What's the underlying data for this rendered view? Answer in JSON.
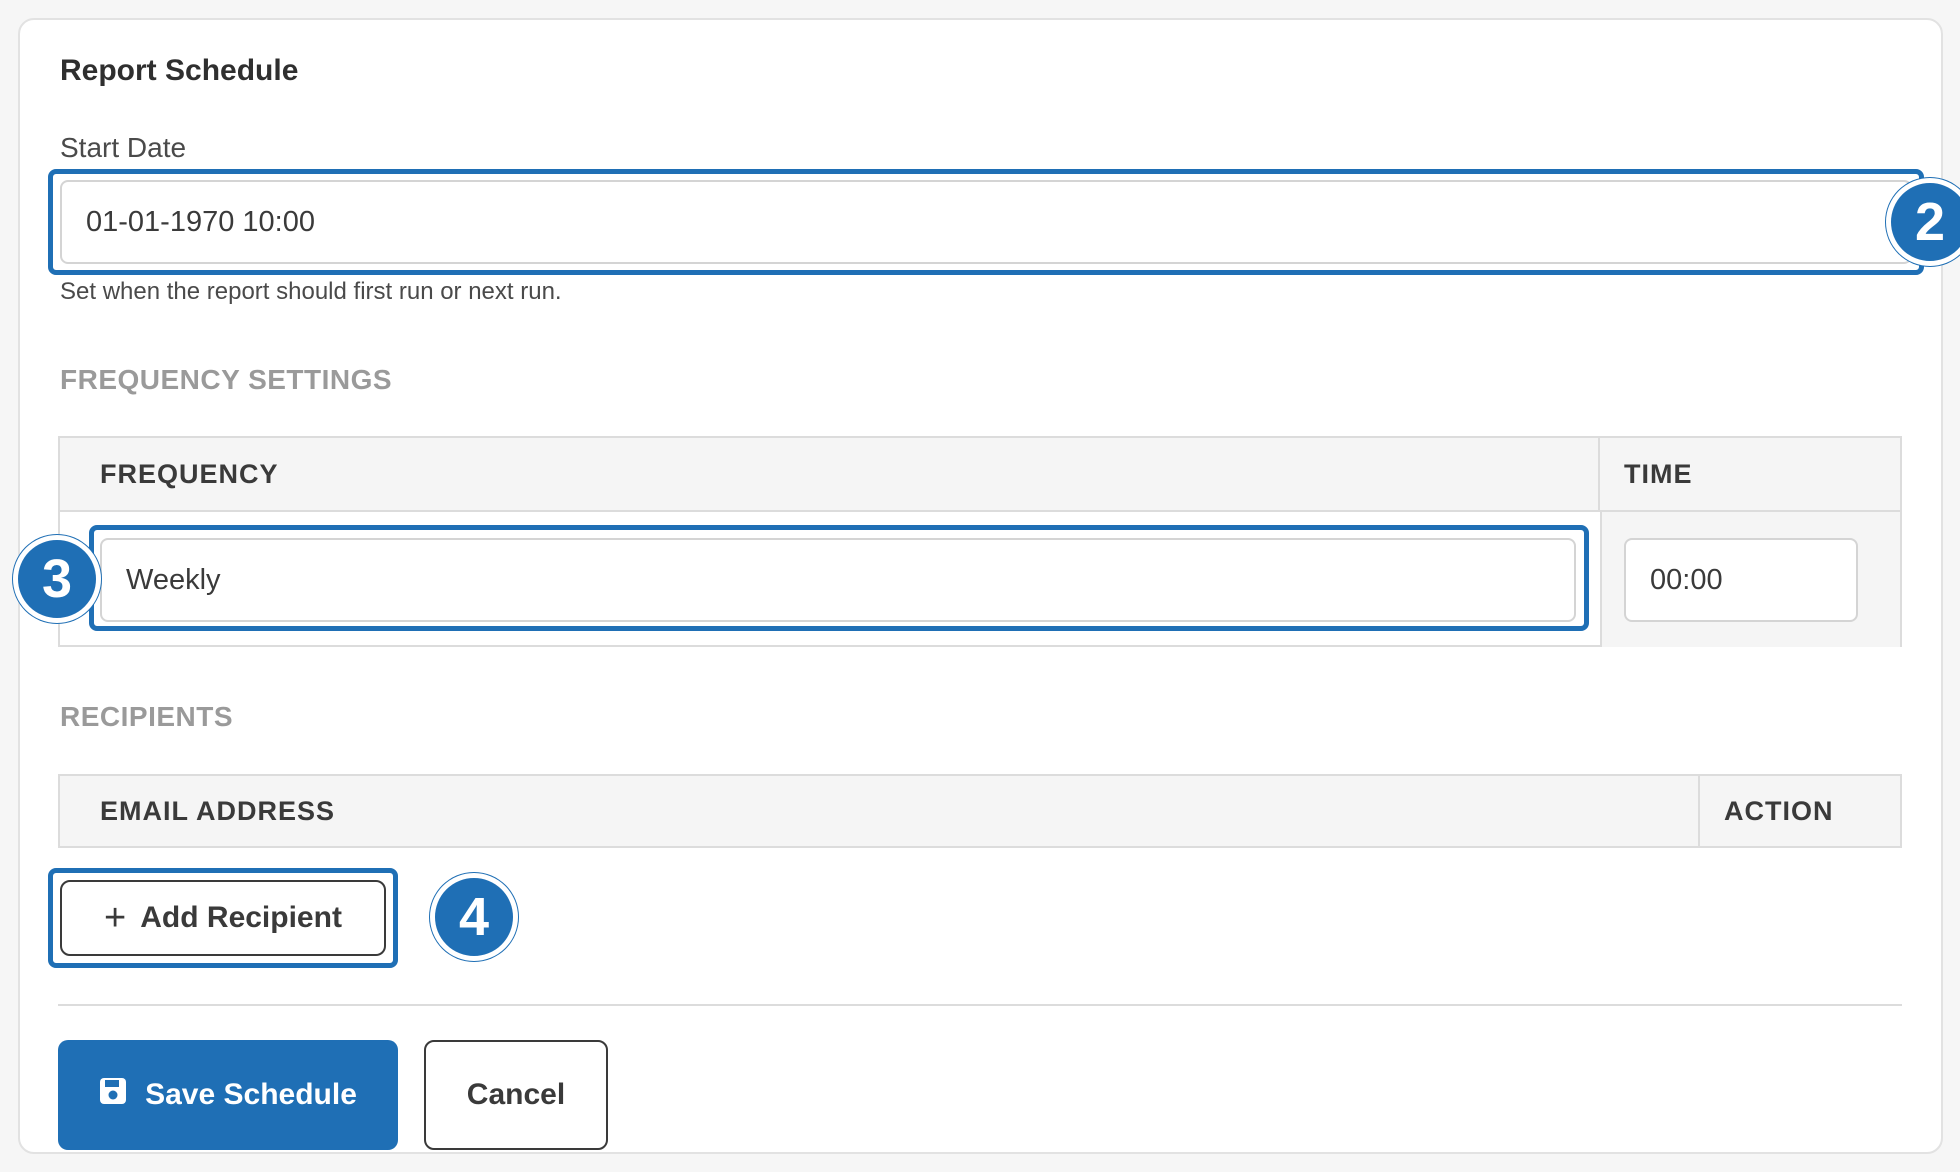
{
  "card": {
    "title": "Report Schedule"
  },
  "start_date": {
    "label": "Start Date",
    "value": "01-01-1970 10:00",
    "help": "Set when the report should first run or next run."
  },
  "frequency_settings": {
    "heading": "FREQUENCY SETTINGS",
    "columns": [
      "FREQUENCY",
      "TIME"
    ],
    "frequency_value": "Weekly",
    "time_value": "00:00"
  },
  "recipients": {
    "heading": "RECIPIENTS",
    "columns": [
      "EMAIL ADDRESS",
      "ACTION"
    ],
    "add_button_label": "Add Recipient"
  },
  "actions": {
    "save_label": "Save Schedule",
    "cancel_label": "Cancel"
  },
  "annotations": {
    "badge_2": "2",
    "badge_3": "3",
    "badge_4": "4"
  },
  "colors": {
    "accent": "#1f6fb5",
    "section_heading": "#9a9a9a"
  },
  "icons": {
    "add": "plus-icon",
    "save": "floppy-disk-icon"
  }
}
